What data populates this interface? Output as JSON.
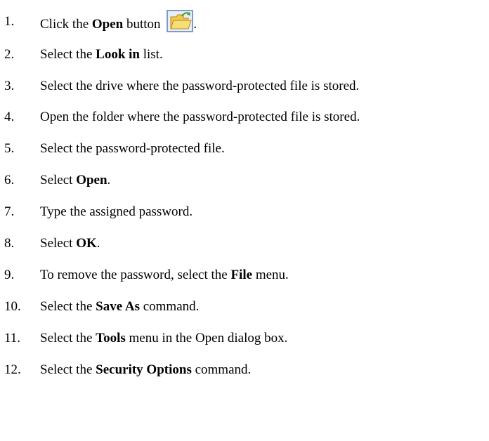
{
  "steps": [
    {
      "number": "1.",
      "parts": [
        "Click the ",
        "Open",
        " button "
      ],
      "trailing": "."
    },
    {
      "number": "2.",
      "parts": [
        "Select the ",
        "Look in",
        " list."
      ]
    },
    {
      "number": "3.",
      "parts": [
        "Select the drive where the password-protected file is stored."
      ]
    },
    {
      "number": "4.",
      "parts": [
        "Open the folder where the password-protected file is stored."
      ]
    },
    {
      "number": "5.",
      "parts": [
        "Select the password-protected file."
      ]
    },
    {
      "number": "6.",
      "parts": [
        "Select ",
        "Open",
        "."
      ]
    },
    {
      "number": "7.",
      "parts": [
        "Type the assigned password."
      ]
    },
    {
      "number": "8.",
      "parts": [
        "Select ",
        "OK",
        "."
      ]
    },
    {
      "number": "9.",
      "parts": [
        "To remove the password, select the ",
        "File",
        " menu."
      ]
    },
    {
      "number": "10.",
      "parts": [
        "Select the ",
        "Save As",
        " command."
      ]
    },
    {
      "number": "11.",
      "parts": [
        "Select the ",
        "Tools",
        " menu in the Open dialog box."
      ]
    },
    {
      "number": "12.",
      "parts": [
        "Select the ",
        "Security Options",
        " command."
      ]
    }
  ],
  "icons": {
    "open_button": "open-folder-icon"
  }
}
